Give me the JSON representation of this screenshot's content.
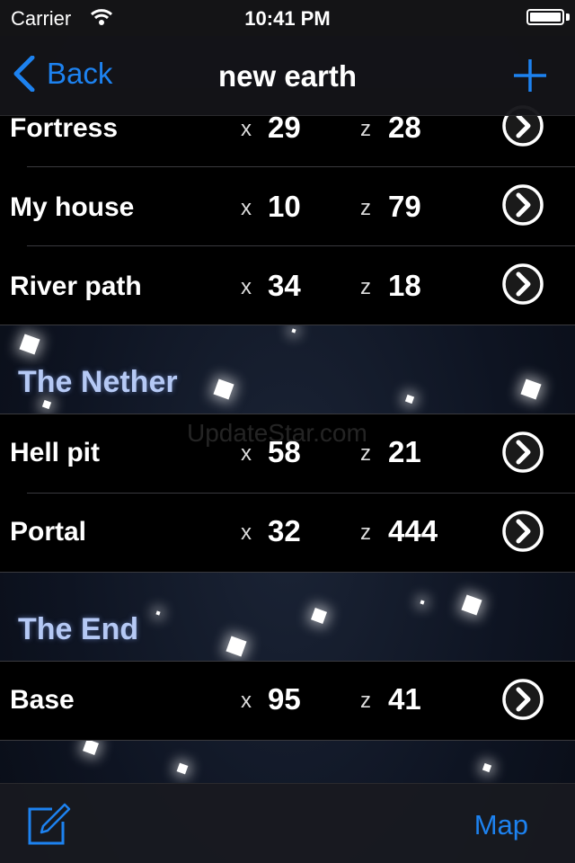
{
  "status_bar": {
    "carrier": "Carrier",
    "time": "10:41 PM"
  },
  "nav": {
    "back_label": "Back",
    "title": "new earth",
    "add_icon": "plus-icon"
  },
  "labels": {
    "x": "x",
    "z": "z"
  },
  "groups": [
    {
      "rows": [
        {
          "name": "Fortress",
          "x": "29",
          "z": "28"
        },
        {
          "name": "My house",
          "x": "10",
          "z": "79"
        },
        {
          "name": "River path",
          "x": "34",
          "z": "18"
        }
      ]
    },
    {
      "title": "The Nether",
      "rows": [
        {
          "name": "Hell pit",
          "x": "58",
          "z": "21"
        },
        {
          "name": "Portal",
          "x": "32",
          "z": "444"
        }
      ]
    },
    {
      "title": "The End",
      "rows": [
        {
          "name": "Base",
          "x": "95",
          "z": "41"
        }
      ]
    }
  ],
  "toolbar": {
    "compose_icon": "compose-icon",
    "map_label": "Map"
  },
  "watermark": "UpdateStar.com",
  "colors": {
    "accent": "#1d82f0",
    "section_title": "#b5c9f5"
  }
}
